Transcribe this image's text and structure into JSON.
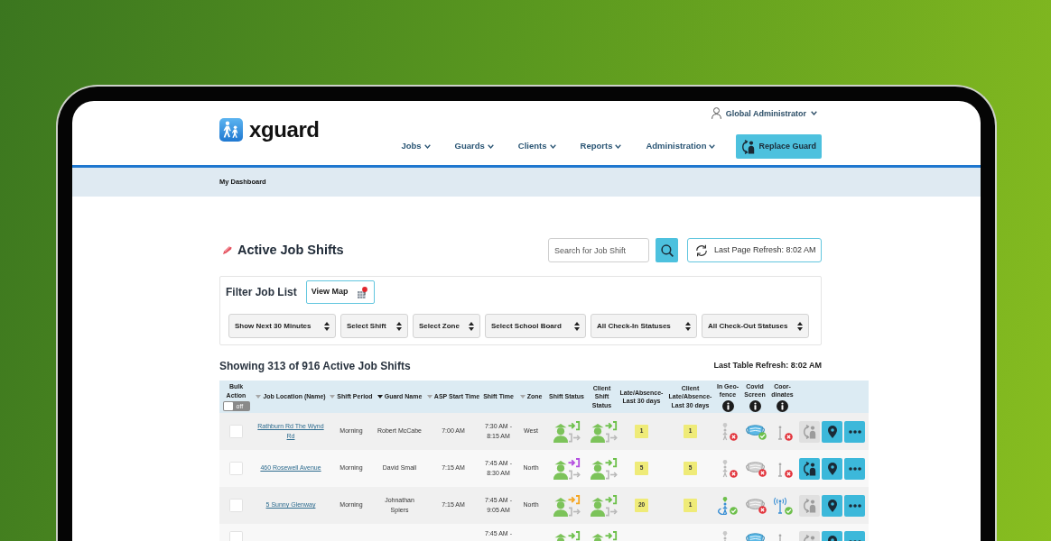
{
  "header": {
    "logo": "xguard",
    "user_menu": "Global Administrator",
    "nav": [
      "Jobs",
      "Guards",
      "Clients",
      "Reports",
      "Administration"
    ],
    "action_button": "Replace Guard"
  },
  "breadcrumb": "My Dashboard",
  "page": {
    "title": "Active Job Shifts",
    "search": {
      "placeholder": "Search for Job Shift"
    },
    "refresh_status": "Last Page Refresh: 8:02 AM"
  },
  "filter": {
    "title": "Filter Job List",
    "map_button": "View Map",
    "dropdowns": [
      "Show Next 30 Minutes",
      "Select Shift",
      "Select Zone",
      "Select School Board",
      "All Check-In Statuses",
      "All Check-Out Statuses"
    ]
  },
  "summary": {
    "showing": "Showing 313 of 916 Active Job Shifts",
    "table_refresh": "Last Table Refresh: 8:02 AM"
  },
  "table": {
    "bulk_action": {
      "label": "Bulk Action",
      "toggle": {
        "label": "off",
        "on": false
      }
    },
    "columns": [
      {
        "label": "Job Location (Name)",
        "kind": "sortable",
        "sorted": false
      },
      {
        "label": "Shift Period",
        "kind": "sortable",
        "sorted": false
      },
      {
        "label": "Guard Name",
        "kind": "sortable",
        "sorted": true
      },
      {
        "label": "ASP Start Time",
        "kind": "sortable",
        "sorted": false
      },
      {
        "label": "Shift Time",
        "kind": "plain",
        "sorted": false
      },
      {
        "label": "Zone",
        "kind": "sortable",
        "sorted": false
      },
      {
        "label": "Shift Status",
        "kind": "plain",
        "sorted": false
      },
      {
        "label": "Client Shift Status",
        "kind": "plain",
        "sorted": false
      },
      {
        "label": "Late/Absence-Last 30 days",
        "kind": "plain",
        "sorted": false
      },
      {
        "label": "Client Late/Absence-Last 30 days",
        "kind": "plain",
        "sorted": false
      },
      {
        "label": "In Geo-fence",
        "kind": "info",
        "sorted": false
      },
      {
        "label": "Covid Screen",
        "kind": "info",
        "sorted": false
      },
      {
        "label": "Coor-dinates",
        "kind": "info",
        "sorted": false
      }
    ],
    "rows": [
      {
        "kind": "full",
        "checked": false,
        "location": "Rathburn Rd The Wynd Rd",
        "shift_period": "Morning",
        "guard": "Robert McCabe",
        "asp_start": "7:00 AM",
        "shift_time": "7:30 AM - 8:15 AM",
        "zone": "West",
        "shift_status": {
          "color": "#6cc04a"
        },
        "client_shift_status": {
          "color": "#6cc04a"
        },
        "late": "1",
        "client_late": "1",
        "in_geofence": false,
        "covid_screen": true,
        "coordinates": false,
        "replace_enabled": false
      },
      {
        "kind": "full",
        "checked": false,
        "location": "460 Rosewell Avenue",
        "shift_period": "Morning",
        "guard": "David Small",
        "asp_start": "7:15 AM",
        "shift_time": "7:45 AM - 8:30 AM",
        "zone": "North",
        "shift_status": {
          "color": "#b44fe0"
        },
        "client_shift_status": {
          "color": "#6cc04a"
        },
        "late": "5",
        "client_late": "5",
        "in_geofence": false,
        "covid_screen": false,
        "coordinates": false,
        "replace_enabled": true
      },
      {
        "kind": "full",
        "checked": false,
        "location": "5 Sunny Glenway",
        "shift_period": "Morning",
        "guard": "Johnathan Spiers",
        "asp_start": "7:15 AM",
        "shift_time": "7:45 AM - 9:05 AM",
        "zone": "North",
        "shift_status": {
          "color": "#f5a623"
        },
        "client_shift_status": {
          "color": "#6cc04a"
        },
        "late": "20",
        "client_late": "1",
        "in_geofence": true,
        "covid_screen": false,
        "coordinates": true,
        "replace_enabled": false
      },
      {
        "kind": "partial",
        "checked": false,
        "shift_time": "7:45 AM -",
        "shift_status": {
          "color": "#6cc04a"
        },
        "client_shift_status": {
          "color": "#6cc04a"
        },
        "in_geofence": false,
        "covid_screen": true,
        "coordinates": false,
        "replace_enabled": false
      }
    ]
  }
}
